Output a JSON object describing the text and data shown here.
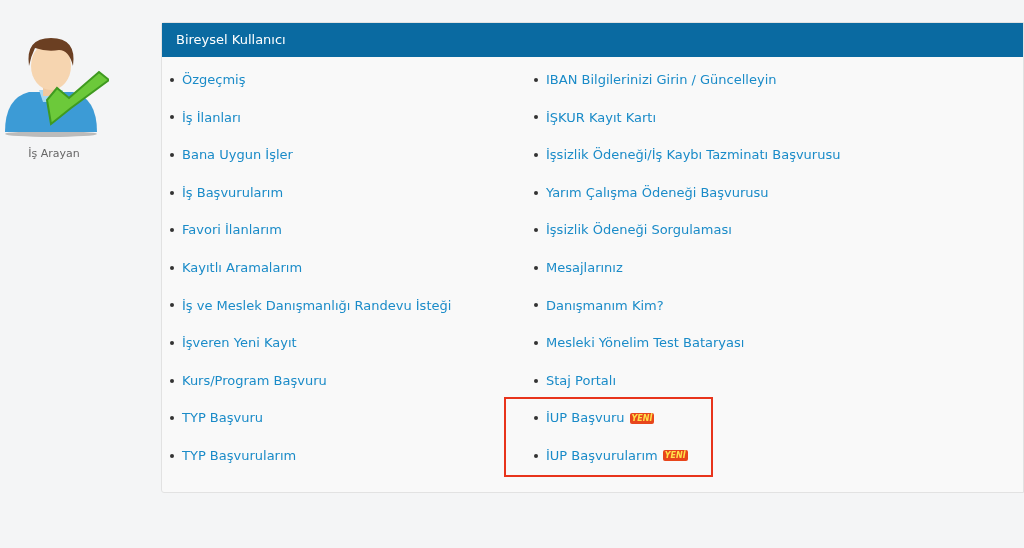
{
  "user": {
    "label": "İş Arayan"
  },
  "panel": {
    "title": "Bireysel Kullanıcı",
    "left_items": [
      {
        "label": "Özgeçmiş"
      },
      {
        "label": "İş İlanları"
      },
      {
        "label": "Bana Uygun İşler"
      },
      {
        "label": "İş Başvurularım"
      },
      {
        "label": "Favori İlanlarım"
      },
      {
        "label": "Kayıtlı Aramalarım"
      },
      {
        "label": "İş ve Meslek Danışmanlığı Randevu İsteği"
      },
      {
        "label": "İşveren Yeni Kayıt"
      },
      {
        "label": "Kurs/Program Başvuru"
      },
      {
        "label": "TYP Başvuru"
      },
      {
        "label": "TYP Başvurularım"
      }
    ],
    "right_items": [
      {
        "label": "IBAN Bilgilerinizi Girin / Güncelleyin",
        "highlighted": false
      },
      {
        "label": "İŞKUR Kayıt Kartı",
        "highlighted": false
      },
      {
        "label": "İşsizlik Ödeneği/İş Kaybı Tazminatı Başvurusu",
        "highlighted": false
      },
      {
        "label": "Yarım Çalışma Ödeneği Başvurusu",
        "highlighted": false
      },
      {
        "label": "İşsizlik Ödeneği Sorgulaması",
        "highlighted": false
      },
      {
        "label": "Mesajlarınız",
        "highlighted": false
      },
      {
        "label": "Danışmanım Kim?",
        "highlighted": false
      },
      {
        "label": "Mesleki Yönelim Test Bataryası",
        "highlighted": false
      },
      {
        "label": "Staj Portalı",
        "highlighted": false
      },
      {
        "label": "İUP Başvuru",
        "badge": "YENİ",
        "highlighted": true
      },
      {
        "label": "İUP Başvurularım",
        "badge": "YENİ",
        "highlighted": true
      }
    ]
  }
}
